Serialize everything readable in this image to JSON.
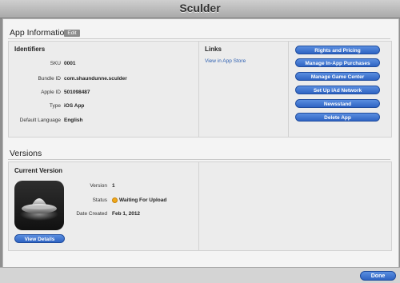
{
  "window": {
    "title": "Sculder"
  },
  "app_information": {
    "title": "App Information",
    "edit_label": "Edit",
    "identifiers": {
      "heading": "Identifiers",
      "rows": [
        {
          "label": "SKU",
          "value": "0001"
        },
        {
          "label": "Bundle ID",
          "value": "com.shaundunne.sculder"
        },
        {
          "label": "Apple ID",
          "value": "501098487"
        },
        {
          "label": "Type",
          "value": "iOS App"
        },
        {
          "label": "Default Language",
          "value": "English"
        }
      ]
    },
    "links": {
      "heading": "Links",
      "view_in_app_store": "View in App Store"
    },
    "actions": [
      "Rights and Pricing",
      "Manage In-App Purchases",
      "Manage Game Center",
      "Set Up iAd Network",
      "Newsstand",
      "Delete App"
    ]
  },
  "versions": {
    "title": "Versions",
    "current_version": {
      "heading": "Current Version",
      "view_details_label": "View Details",
      "rows": [
        {
          "label": "Version",
          "value": "1"
        },
        {
          "label": "Status",
          "value": "Waiting For Upload"
        },
        {
          "label": "Date Created",
          "value": "Feb 1, 2012"
        }
      ],
      "status_color": "#f0a81a"
    }
  },
  "footer": {
    "done_label": "Done"
  },
  "colors": {
    "accent": "#3b6fd0",
    "link": "#2d5fb0"
  }
}
